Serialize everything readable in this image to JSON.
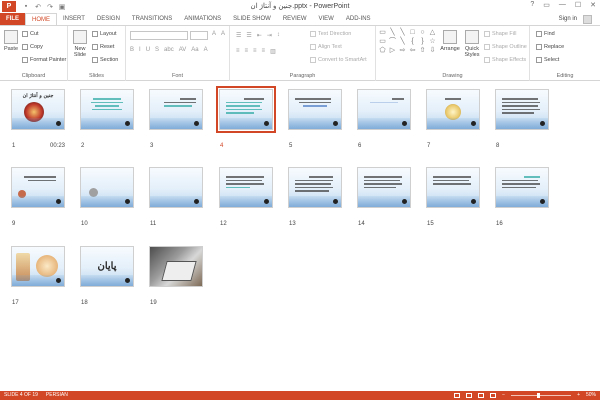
{
  "window": {
    "title": "جنین و آنتاژ ان.pptx - PowerPoint",
    "app_logo": "P",
    "controls": [
      "?",
      "▭",
      "—",
      "☐",
      "✕"
    ]
  },
  "qat": [
    "save-icon",
    "undo-icon",
    "redo-icon",
    "present-icon"
  ],
  "tabs": [
    "FILE",
    "HOME",
    "INSERT",
    "DESIGN",
    "TRANSITIONS",
    "ANIMATIONS",
    "SLIDE SHOW",
    "REVIEW",
    "VIEW",
    "ADD-INS"
  ],
  "active_tab": "HOME",
  "signin": "Sign in",
  "ribbon": {
    "clipboard": {
      "label": "Clipboard",
      "paste": "Paste",
      "cut": "Cut",
      "copy": "Copy",
      "format_painter": "Format Painter"
    },
    "slides": {
      "label": "Slides",
      "new_slide": "New",
      "new_slide2": "Slide",
      "layout": "Layout",
      "reset": "Reset",
      "section": "Section"
    },
    "font": {
      "label": "Font",
      "format_glyphs": [
        "B",
        "I",
        "U",
        "S",
        "abc",
        "AV",
        "Aa",
        "A"
      ]
    },
    "paragraph": {
      "label": "Paragraph",
      "text_direction": "Text Direction",
      "align_text": "Align Text",
      "convert_smartart": "Convert to SmartArt"
    },
    "drawing": {
      "label": "Drawing",
      "arrange": "Arrange",
      "quick_styles": "Quick",
      "quick_styles2": "Styles",
      "shape_fill": "Shape Fill",
      "shape_outline": "Shape Outline",
      "shape_effects": "Shape Effects",
      "shapes": [
        "▭",
        "╲",
        "╲",
        "□",
        "○",
        "△",
        "▭",
        "⌒",
        "╲",
        "{",
        "}",
        "☆",
        "⬠",
        "▷",
        "⇨",
        "⇦",
        "⇧",
        "⇩"
      ]
    },
    "editing": {
      "label": "Editing",
      "find": "Find",
      "replace": "Replace",
      "select": "Select"
    }
  },
  "slides": [
    {
      "num": "1",
      "time": "00:23",
      "title": "جنین و آنتاژ ان"
    },
    {
      "num": "2"
    },
    {
      "num": "3"
    },
    {
      "num": "4",
      "selected": true
    },
    {
      "num": "5"
    },
    {
      "num": "6"
    },
    {
      "num": "7"
    },
    {
      "num": "8"
    },
    {
      "num": "9"
    },
    {
      "num": "10"
    },
    {
      "num": "11"
    },
    {
      "num": "12"
    },
    {
      "num": "13"
    },
    {
      "num": "14"
    },
    {
      "num": "15"
    },
    {
      "num": "16"
    },
    {
      "num": "17"
    },
    {
      "num": "18",
      "title": "پایان"
    },
    {
      "num": "19"
    }
  ],
  "status": {
    "slide_info": "SLIDE 4 OF 19",
    "language": "PERSIAN",
    "zoom": "50%"
  },
  "colors": {
    "accent": "#D24726",
    "selection": "#D24726"
  }
}
